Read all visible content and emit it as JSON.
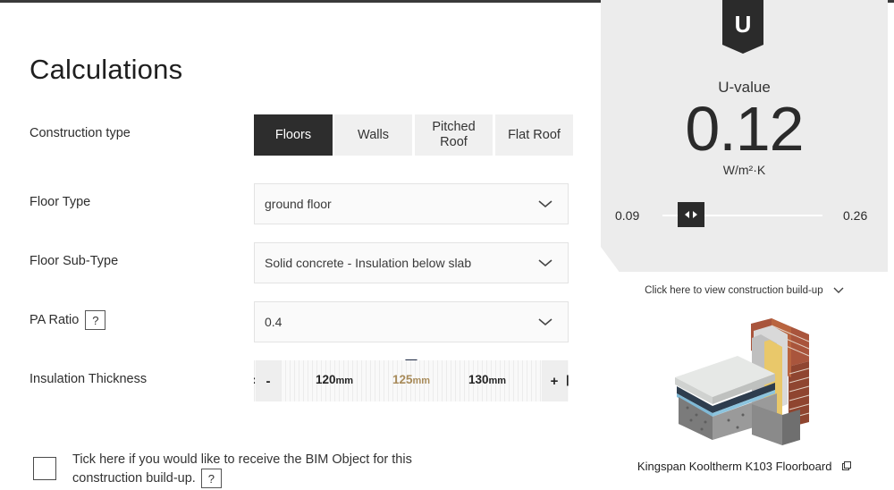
{
  "page": {
    "title": "Calculations"
  },
  "construction": {
    "label": "Construction type",
    "tabs": [
      {
        "label": "Floors",
        "active": true
      },
      {
        "label": "Walls",
        "active": false
      },
      {
        "label": "Pitched Roof",
        "active": false
      },
      {
        "label": "Flat Roof",
        "active": false
      }
    ]
  },
  "floor_type": {
    "label": "Floor Type",
    "value": "ground floor"
  },
  "floor_sub_type": {
    "label": "Floor Sub-Type",
    "value": "Solid concrete - Insulation below slab"
  },
  "pa_ratio": {
    "label": "PA Ratio",
    "help": "?",
    "value": "0.4"
  },
  "insulation": {
    "label": "Insulation Thickness",
    "minus": "-",
    "plus": "+",
    "unit": "mm",
    "ticks": [
      "120",
      "125",
      "130"
    ],
    "selected": "125"
  },
  "bim": {
    "text": "Tick here if you would like to receive the BIM Object for this construction build-up.",
    "help": "?",
    "checked": false
  },
  "uvalue": {
    "badge": "U",
    "label": "U-value",
    "value": "0.12",
    "unit": "W/m²·K",
    "min": "0.09",
    "max": "0.26",
    "slider_position": 0.18
  },
  "buildup": {
    "link_text": "Click here to view construction build-up",
    "product_name": "Kingspan Kooltherm K103 Floorboard"
  },
  "colors": {
    "active_tab": "#2d2d2d",
    "panel_bg": "#ececec",
    "selected_tick": "#a88b5a",
    "marker": "#1e2a44"
  }
}
